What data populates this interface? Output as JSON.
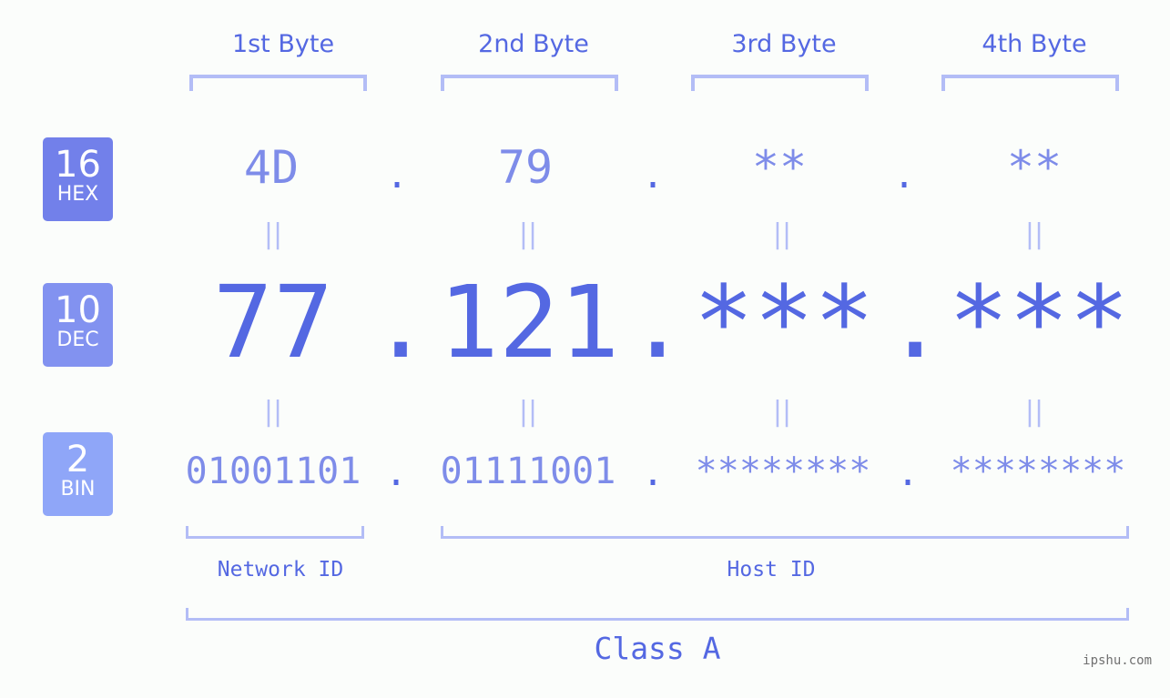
{
  "bytes": [
    {
      "label": "1st Byte",
      "hex": "4D",
      "dec": "77",
      "bin": "01001101"
    },
    {
      "label": "2nd Byte",
      "hex": "79",
      "dec": "121",
      "bin": "01111001"
    },
    {
      "label": "3rd Byte",
      "hex": "**",
      "dec": "***",
      "bin": "********"
    },
    {
      "label": "4th Byte",
      "hex": "**",
      "dec": "***",
      "bin": "********"
    }
  ],
  "badges": {
    "hex": {
      "num": "16",
      "label": "HEX",
      "color": "#7280ea"
    },
    "dec": {
      "num": "10",
      "label": "DEC",
      "color": "#8292f0"
    },
    "bin": {
      "num": "2",
      "label": "BIN",
      "color": "#8fa6f8"
    }
  },
  "separator": ".",
  "equals": "||",
  "network_id": "Network ID",
  "host_id": "Host ID",
  "class_label": "Class A",
  "watermark": "ipshu.com"
}
